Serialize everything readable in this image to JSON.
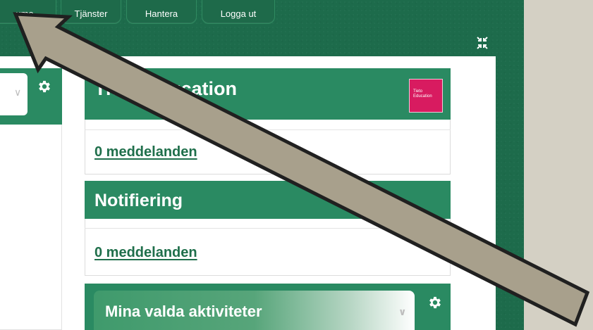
{
  "nav": {
    "items": [
      {
        "label": "umo"
      },
      {
        "label": "Tjänster"
      },
      {
        "label": "Hantera"
      },
      {
        "label": "Logga ut"
      }
    ]
  },
  "cards": {
    "tieto": {
      "title": "Tieto Education",
      "messages": "0 meddelanden",
      "logo_text": "Tieto Education"
    },
    "notifiering": {
      "title": "Notifiering",
      "messages": "0 meddelanden"
    },
    "activities": {
      "label": "Mina valda aktiviteter"
    }
  },
  "colors": {
    "app_green": "#1d6b4b",
    "header_green": "#2a8a62",
    "link_green": "#1f6f4b",
    "logo_pink": "#d81b60",
    "arrow_fill": "#a8a08c"
  },
  "icons": [
    "gear-icon",
    "chevron-down-icon",
    "collapse-icon",
    "arrow-pointer"
  ]
}
